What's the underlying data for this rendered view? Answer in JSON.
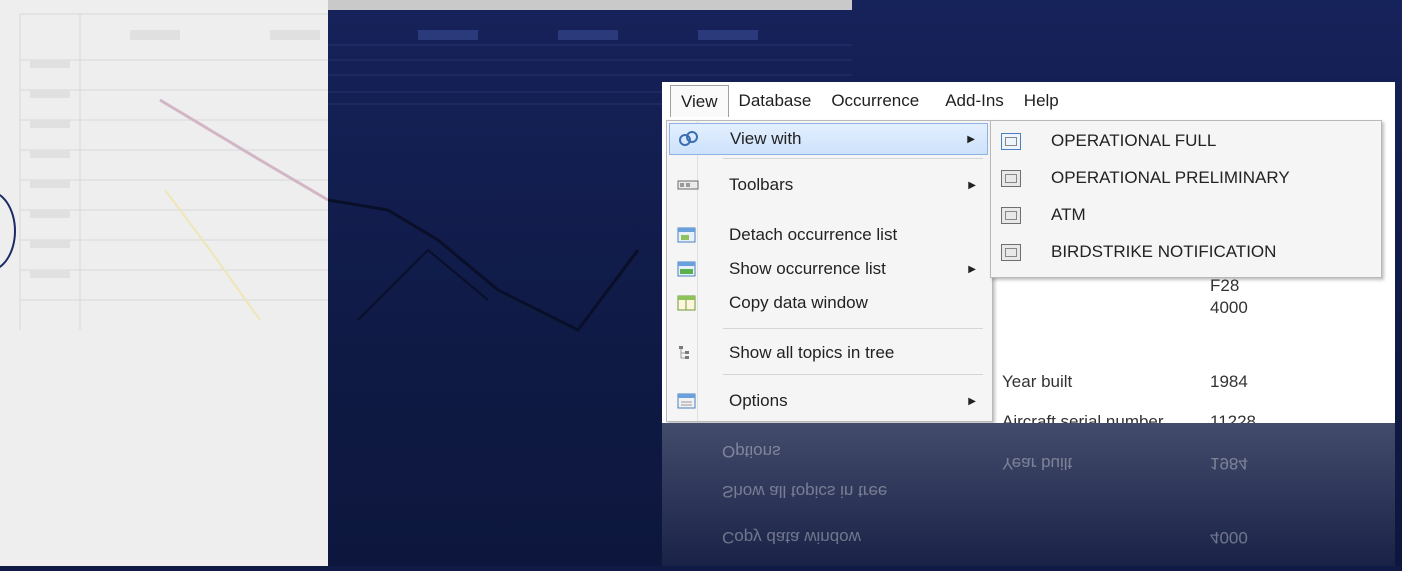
{
  "menubar": {
    "items": [
      "View",
      "Database",
      "Occurrence",
      "Add-Ins",
      "Help"
    ]
  },
  "view_menu": {
    "items": [
      {
        "label": "View with",
        "icon": "glasses-icon",
        "submenu": true
      },
      {
        "label": "Toolbars",
        "icon": "toolbar-icon",
        "submenu": true
      },
      {
        "label": "Detach occurrence list",
        "icon": "detach-window-icon",
        "submenu": false
      },
      {
        "label": "Show occurrence list",
        "icon": "list-window-icon",
        "submenu": true
      },
      {
        "label": "Copy data window",
        "icon": "copy-window-icon",
        "submenu": false
      },
      {
        "label": "Show all topics in tree",
        "icon": "tree-icon",
        "submenu": false
      },
      {
        "label": "Options",
        "icon": "options-icon",
        "submenu": true
      }
    ]
  },
  "view_with_submenu": {
    "items": [
      "OPERATIONAL FULL",
      "OPERATIONAL PRELIMINARY",
      "ATM",
      "BIRDSTRIKE NOTIFICATION"
    ]
  },
  "background_fields": {
    "value_1": "F28",
    "value_2": "4000",
    "year_built_label": "Year built",
    "year_built_value": "1984",
    "serial_label": "Aircraft serial number",
    "serial_value": "11228"
  },
  "colors": {
    "slide_background": "#0f1a45",
    "menu_highlight": "#cde2fb"
  }
}
